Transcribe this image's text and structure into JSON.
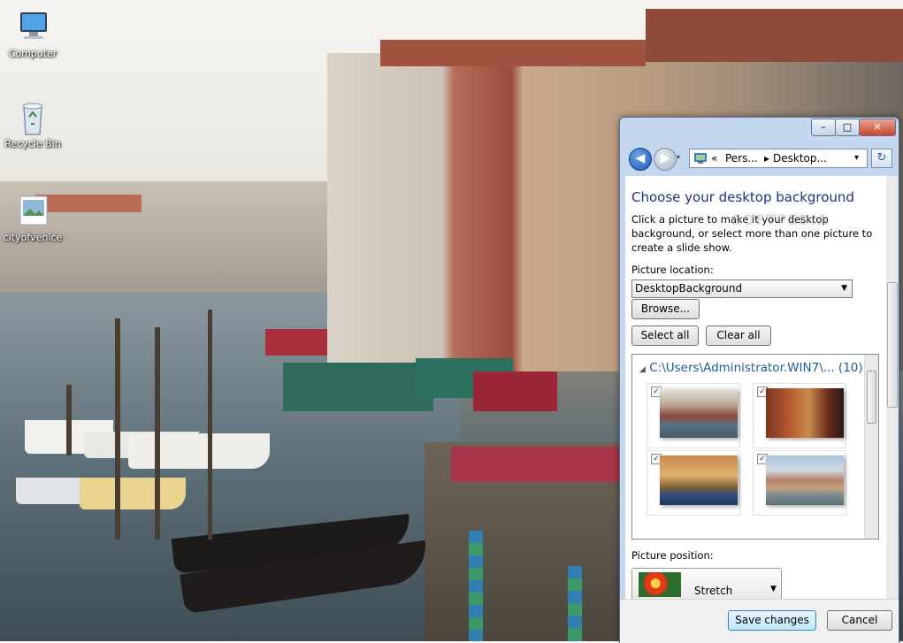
{
  "desktop": {
    "icons": [
      {
        "label": "Computer"
      },
      {
        "label": "Recycle Bin"
      },
      {
        "label": "cityofvenice"
      }
    ]
  },
  "window": {
    "title_buttons": {
      "minimize": "–",
      "maximize": "□",
      "close": "✕"
    },
    "nav": {
      "back_glyph": "◀",
      "forward_glyph": "▶",
      "address_segments": [
        "«",
        "Pers...",
        "▸",
        "Desktop..."
      ],
      "address_dropdown": "▾",
      "refresh_glyph": "↻"
    },
    "heading": "Choose your desktop background",
    "description": "Click a picture to make it your desktop background, or select more than one picture to create a slide show.",
    "watermark": "SOFTPEDIA",
    "picture_location": {
      "label": "Picture location:",
      "selected": "DesktopBackground",
      "arrow": "▼"
    },
    "buttons": {
      "browse": "Browse...",
      "select_all": "Select all",
      "clear_all": "Clear all",
      "save": "Save changes",
      "cancel": "Cancel"
    },
    "gallery": {
      "collapse_glyph": "◢",
      "path": "C:\\Users\\Administrator.WIN7\\...",
      "count": "(10)",
      "items": [
        {
          "checked": "✓",
          "icon": "venice-canal-icon"
        },
        {
          "checked": "✓",
          "icon": "venice-canal-green-icon"
        },
        {
          "checked": "✓",
          "icon": "venice-gondola-icon"
        },
        {
          "checked": "✓",
          "icon": "venice-waterfront-icon"
        }
      ]
    },
    "picture_position": {
      "label": "Picture position:",
      "selected": "Stretch",
      "arrow": "▼"
    }
  },
  "colors": {
    "heading": "#1e3287",
    "link_blue": "#1e5aa8",
    "window_frame": "#c5d7ee"
  }
}
